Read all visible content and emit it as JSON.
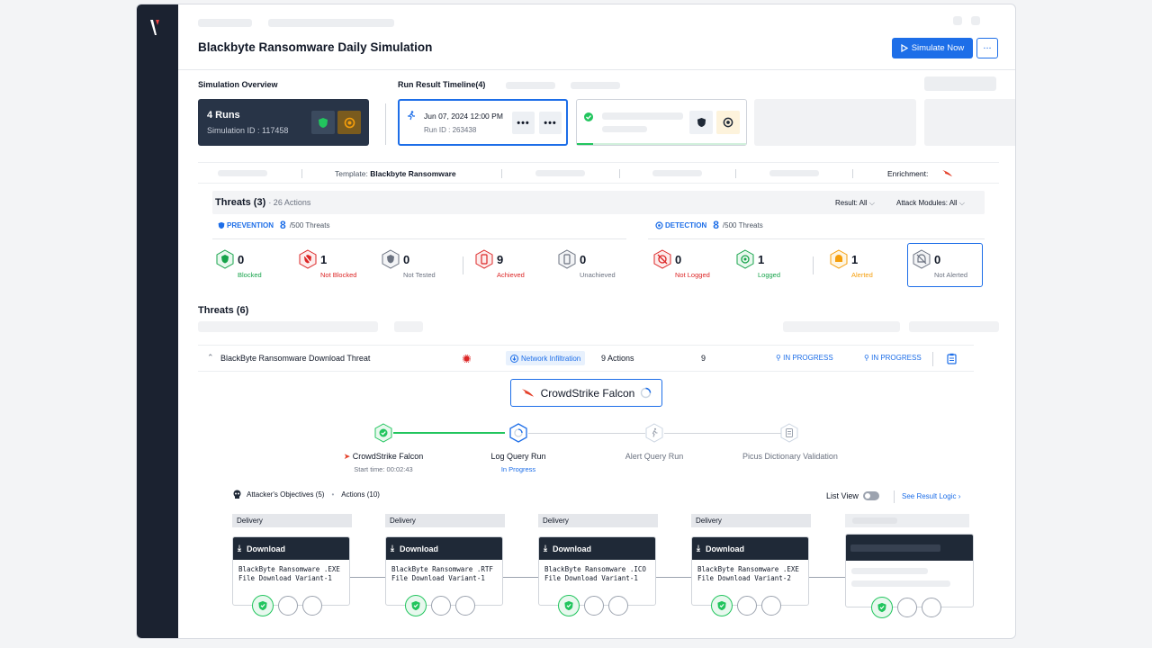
{
  "header": {
    "title": "Blackbyte Ransomware Daily Simulation",
    "simulate_label": "Simulate Now",
    "more_label": "..."
  },
  "overview": {
    "label": "Simulation Overview",
    "runs": "4 Runs",
    "sim_id": "Simulation ID : 117458"
  },
  "timeline": {
    "label": "Run Result Timeline(4)",
    "selected_run": {
      "date": "Jun 07, 2024 12:00 PM",
      "run_id": "Run ID : 263438",
      "dots": "•••"
    }
  },
  "info_bar": {
    "template_prefix": "Template:",
    "template_name": "Blackbyte Ransomware",
    "enrichment_label": "Enrichment:"
  },
  "threats_summary": {
    "title": "Threats (3)",
    "subtitle": "· 26 Actions",
    "result_filter": "Result: All",
    "modules_filter": "Attack Modules: All",
    "prevention": {
      "label": "PREVENTION",
      "count": "8",
      "total": "/500 Threats"
    },
    "detection": {
      "label": "DETECTION",
      "count": "8",
      "total": "/500 Threats"
    },
    "stats": [
      {
        "num": "0",
        "label": "Blocked",
        "color": "#16a34a"
      },
      {
        "num": "1",
        "label": "Not Blocked",
        "color": "#dc2626"
      },
      {
        "num": "0",
        "label": "Not Tested",
        "color": "#6b7280"
      },
      {
        "num": "9",
        "label": "Achieved",
        "color": "#dc2626"
      },
      {
        "num": "0",
        "label": "Unachieved",
        "color": "#6b7280"
      },
      {
        "num": "0",
        "label": "Not Logged",
        "color": "#dc2626"
      },
      {
        "num": "1",
        "label": "Logged",
        "color": "#16a34a"
      },
      {
        "num": "1",
        "label": "Alerted",
        "color": "#f59e0b"
      },
      {
        "num": "0",
        "label": "Not Alerted",
        "color": "#6b7280"
      }
    ]
  },
  "threats_list": {
    "title": "Threats (6)",
    "row": {
      "name": "BlackByte Ransomware Download Threat",
      "module": "Network Infiltration",
      "actions": "9 Actions",
      "count": "9",
      "status1": "IN PROGRESS",
      "status2": "IN PROGRESS"
    }
  },
  "integration": {
    "name": "CrowdStrike Falcon",
    "steps": [
      {
        "label": "CrowdStrike Falcon",
        "sub": "Start time: 00:02:43"
      },
      {
        "label": "Log Query Run",
        "sub": "In Progress"
      },
      {
        "label": "Alert Query Run",
        "sub": ""
      },
      {
        "label": "Picus Dictionary Validation",
        "sub": ""
      }
    ]
  },
  "objectives": {
    "label": "Attacker's Objectives (5)",
    "actions": "Actions (10)",
    "list_view": "List View",
    "see_logic": "See Result Logic"
  },
  "actions": [
    {
      "stage": "Delivery",
      "title": "Download",
      "line1": "BlackByte Ransomware .EXE",
      "line2": "File Download Variant-1"
    },
    {
      "stage": "Delivery",
      "title": "Download",
      "line1": "BlackByte Ransomware .RTF",
      "line2": "File Download Variant-1"
    },
    {
      "stage": "Delivery",
      "title": "Download",
      "line1": "BlackByte Ransomware .ICO",
      "line2": "File Download Variant-1"
    },
    {
      "stage": "Delivery",
      "title": "Download",
      "line1": "BlackByte Ransomware .EXE",
      "line2": "File Download Variant-2"
    }
  ],
  "colors": {
    "accent": "#1d6ee8",
    "sidebar": "#1b2230",
    "success": "#22c55e",
    "danger": "#dc2626",
    "warning": "#f59e0b"
  }
}
